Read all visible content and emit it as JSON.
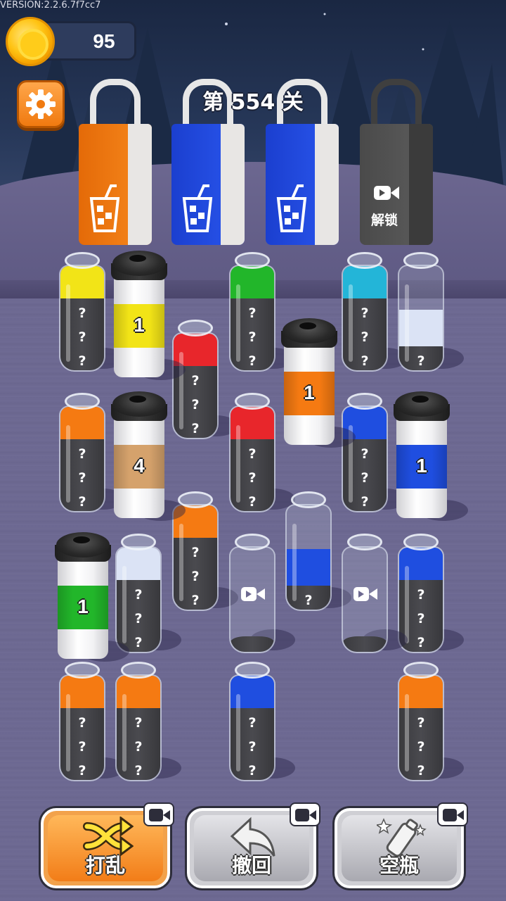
{
  "version": "VERSION:2.2.6.7f7cc7",
  "coins": "95",
  "level_title": "第 554 关",
  "colors": {
    "yellow": "#f2e417",
    "green": "#22b62a",
    "red": "#e8262b",
    "orange": "#f57a12",
    "cyan": "#23b5d8",
    "blue": "#1f4ee0",
    "lightblue": "#dbe3f5",
    "tan": "#d5a26c"
  },
  "bags": [
    {
      "color": "orange",
      "state": "available"
    },
    {
      "color": "blue",
      "state": "available"
    },
    {
      "color": "blue",
      "state": "available"
    },
    {
      "color": "gray",
      "state": "locked",
      "label": "解锁",
      "icon": "video-icon"
    }
  ],
  "hidden_mark": "?",
  "bottles": [
    {
      "id": "b1",
      "color": "yellow",
      "hidden": 3
    },
    {
      "id": "b2",
      "color": "green",
      "hidden": 3
    },
    {
      "id": "b3",
      "color": "cyan",
      "hidden": 3
    },
    {
      "id": "b4",
      "color": "lightblue",
      "hidden": 1
    },
    {
      "id": "b5",
      "color": "red",
      "hidden": 3
    },
    {
      "id": "b6",
      "color": "orange",
      "hidden": 3
    },
    {
      "id": "b7",
      "color": "red",
      "hidden": 3
    },
    {
      "id": "b8",
      "color": "blue",
      "hidden": 3
    },
    {
      "id": "b9",
      "color": "orange",
      "hidden": 3
    },
    {
      "id": "b10",
      "color": "lightblue",
      "hidden": 3
    },
    {
      "id": "b11",
      "color": "blue",
      "hidden": 1
    },
    {
      "id": "b12",
      "color": "blue",
      "hidden": 3
    },
    {
      "id": "b13",
      "color": "orange",
      "hidden": 3
    },
    {
      "id": "b14",
      "color": "orange",
      "hidden": 3
    },
    {
      "id": "b15",
      "color": "blue",
      "hidden": 3
    },
    {
      "id": "b16",
      "color": "orange",
      "hidden": 3
    },
    {
      "id": "b17",
      "state": "locked-empty",
      "icon": "video-icon"
    },
    {
      "id": "b18",
      "state": "locked-empty",
      "icon": "video-icon"
    }
  ],
  "cups": [
    {
      "id": "c1",
      "color": "yellow",
      "count": "1"
    },
    {
      "id": "c2",
      "color": "orange",
      "count": "1"
    },
    {
      "id": "c3",
      "color": "tan",
      "count": "4"
    },
    {
      "id": "c4",
      "color": "blue",
      "count": "1"
    },
    {
      "id": "c5",
      "color": "green",
      "count": "1"
    }
  ],
  "actions": {
    "shuffle": {
      "label": "打乱",
      "icon": "shuffle-icon",
      "badge": "video-icon"
    },
    "undo": {
      "label": "撤回",
      "icon": "undo-arrow-icon",
      "badge": "video-icon"
    },
    "empty_bottle": {
      "label": "空瓶",
      "icon": "empty-bottle-icon",
      "badge": "video-icon"
    }
  }
}
